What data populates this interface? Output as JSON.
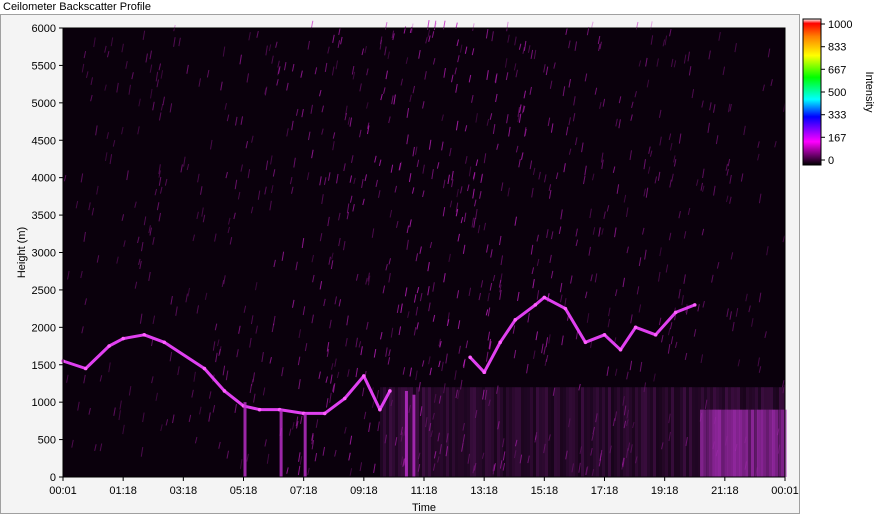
{
  "window": {
    "title": "Ceilometer Backscatter Profile"
  },
  "chart_data": {
    "type": "heatmap",
    "title": "Ceilometer Backscatter Profile",
    "xlabel": "Time",
    "ylabel": "Height (m)",
    "x_ticks": [
      "00:01",
      "01:18",
      "03:18",
      "05:18",
      "07:18",
      "09:18",
      "11:18",
      "13:18",
      "15:18",
      "17:18",
      "19:18",
      "21:18",
      "00:01"
    ],
    "y_ticks": [
      0,
      500,
      1000,
      1500,
      2000,
      2500,
      3000,
      3500,
      4000,
      4500,
      5000,
      5500,
      6000
    ],
    "ylim": [
      0,
      6000
    ],
    "colorbar": {
      "label": "Intensity",
      "ticks": [
        0,
        167,
        333,
        500,
        667,
        833,
        1000
      ],
      "range": [
        0,
        1000
      ],
      "colors": [
        "#000000",
        "#ff00ff",
        "#0000ff",
        "#00ffff",
        "#00ff00",
        "#ffff00",
        "#ff8000",
        "#ff0000",
        "#ffffff"
      ]
    },
    "series": [
      {
        "values": [
          {
            "t": "00:01",
            "h": 1550
          },
          {
            "t": "00:30",
            "h": 1450
          },
          {
            "t": "01:00",
            "h": 1750
          },
          {
            "t": "01:18",
            "h": 1850
          },
          {
            "t": "02:00",
            "h": 1900
          },
          {
            "t": "02:40",
            "h": 1800
          },
          {
            "t": "04:00",
            "h": 1450
          },
          {
            "t": "04:40",
            "h": 1150
          },
          {
            "t": "05:18",
            "h": 950
          },
          {
            "t": "05:50",
            "h": 900
          },
          {
            "t": "06:30",
            "h": 900
          },
          {
            "t": "07:18",
            "h": 850
          },
          {
            "t": "08:00",
            "h": 850
          },
          {
            "t": "08:40",
            "h": 1050
          },
          {
            "t": "09:18",
            "h": 1350
          },
          {
            "t": "09:50",
            "h": 900
          },
          {
            "t": "10:10",
            "h": 1150
          }
        ]
      },
      {
        "values": [
          {
            "t": "12:50",
            "h": 1600
          },
          {
            "t": "13:18",
            "h": 1400
          },
          {
            "t": "13:50",
            "h": 1800
          },
          {
            "t": "14:20",
            "h": 2100
          },
          {
            "t": "15:00",
            "h": 2300
          },
          {
            "t": "15:18",
            "h": 2400
          },
          {
            "t": "16:00",
            "h": 2250
          },
          {
            "t": "16:40",
            "h": 1800
          },
          {
            "t": "17:18",
            "h": 1900
          },
          {
            "t": "17:50",
            "h": 1700
          },
          {
            "t": "18:20",
            "h": 2000
          },
          {
            "t": "19:00",
            "h": 1900
          },
          {
            "t": "19:40",
            "h": 2200
          },
          {
            "t": "20:18",
            "h": 2300
          }
        ]
      }
    ]
  }
}
